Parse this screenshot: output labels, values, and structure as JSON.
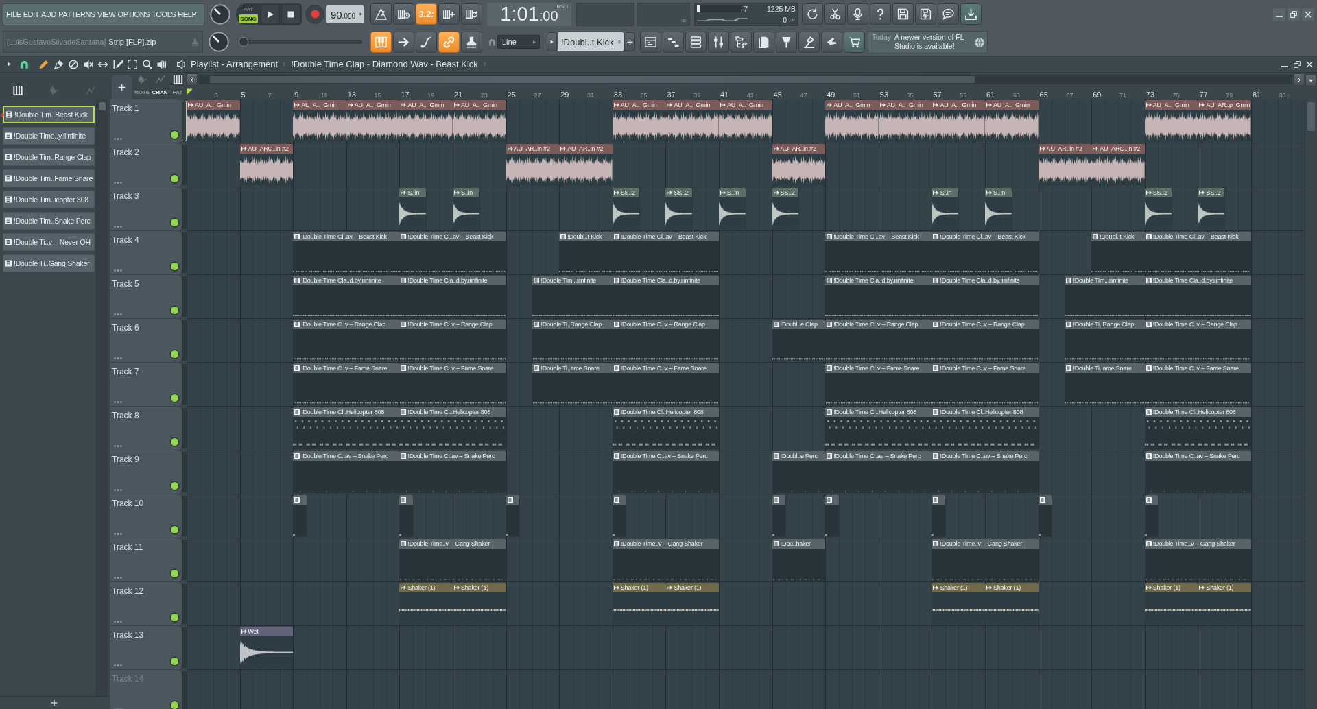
{
  "menu": [
    "FILE",
    "EDIT",
    "ADD",
    "PATTERNS",
    "VIEW",
    "OPTIONS",
    "TOOLS",
    "HELP"
  ],
  "mode": [
    {
      "label": "PAT",
      "selected": false
    },
    {
      "label": "SONG",
      "selected": true
    }
  ],
  "tempo": "90.000",
  "record_options": [
    {
      "on": false
    },
    {
      "on": false
    },
    {
      "label": "3.2:",
      "on": true
    },
    {
      "on": false
    },
    {
      "on": false
    }
  ],
  "time": {
    "value": "1:01:00",
    "units": "B:S:T"
  },
  "cpu_meter": {
    "level": 0.06
  },
  "readings": [
    "7",
    "1225 MB",
    "0"
  ],
  "hint": {
    "prefix": "[LuisGustavoSilvadeSantana]",
    "text": "Strip [FLP].zip"
  },
  "song_position": {
    "level": 0
  },
  "snap_tools": [
    {
      "on": true
    },
    {
      "on": false
    },
    {
      "on": false
    },
    {
      "on": true
    },
    {
      "on": false
    }
  ],
  "snap": "Line",
  "pattern": "!Doubl..t Kick",
  "news": {
    "date": "Today",
    "text": "A newer version of FL Studio is available!"
  },
  "playlist": {
    "title": "Playlist - Arrangement",
    "pattern": "!Double Time Clap - Diamond Wav - Beast Kick",
    "tools": [
      {
        "selected": true
      },
      {
        "selected": false
      },
      {
        "selected": false
      },
      {
        "selected": false
      },
      {
        "selected": false
      },
      {
        "selected": false
      },
      {
        "selected": false
      },
      {
        "selected": false
      },
      {
        "selected": false
      }
    ],
    "picker_filters": [
      {
        "on": true
      },
      {
        "on": false
      },
      {
        "on": false
      }
    ],
    "view_toggles": [
      {
        "on": false
      },
      {
        "on": false
      },
      {
        "on": true
      }
    ],
    "clip_filters": [
      {
        "label": "NOTE",
        "selected": false
      },
      {
        "label": "CHAN",
        "selected": true
      },
      {
        "label": "PAT",
        "selected": false
      }
    ],
    "picker": [
      {
        "label": "!Double Tim..Beast Kick",
        "selected": true
      },
      {
        "label": "!Double Time..y.iiinfinite",
        "selected": false
      },
      {
        "label": "!Double Tim..Range Clap",
        "selected": false
      },
      {
        "label": "!Double Tim..Fame Snare",
        "selected": false
      },
      {
        "label": "!Double Tim..icopter 808",
        "selected": false
      },
      {
        "label": "!Double Tim..Snake Perc",
        "selected": false
      },
      {
        "label": "!Double Ti..v – Never OH",
        "selected": false
      },
      {
        "label": "!Double Ti..Gang Shaker",
        "selected": false
      }
    ],
    "ruler": [
      "3",
      "5",
      "7",
      "9",
      "11",
      "13",
      "15",
      "17",
      "19",
      "21",
      "23",
      "25",
      "27",
      "29",
      "31",
      "33",
      "35",
      "37",
      "39",
      "41",
      "43",
      "45",
      "47",
      "49",
      "51",
      "53",
      "55",
      "57",
      "59",
      "61",
      "63",
      "65",
      "67",
      "69",
      "71",
      "73",
      "75",
      "77",
      "79",
      "81",
      "83"
    ],
    "tracks": [
      {
        "name": "Track 1",
        "selected": true,
        "muted": false,
        "dimmed": false,
        "clips": [
          {
            "kind": "audio",
            "label": "AU_A.._Gmin",
            "color": "#7d5b59"
          },
          {
            "kind": "audio",
            "label": "AU_A.._Gmin",
            "color": "#7d5b59"
          },
          {
            "kind": "audio",
            "label": "AU_A.._Gmin",
            "color": "#7d5b59"
          },
          {
            "kind": "audio",
            "label": "AU_A.._Gmin",
            "color": "#7d5b59"
          },
          {
            "kind": "audio",
            "label": "AU_A.._Gmin",
            "color": "#7d5b59"
          },
          {
            "kind": "audio",
            "label": "AU_A.._Gmin",
            "color": "#7d5b59"
          },
          {
            "kind": "audio",
            "label": "AU_A.._Gmin",
            "color": "#7d5b59"
          },
          {
            "kind": "audio",
            "label": "AU_A.._Gmin",
            "color": "#7d5b59"
          },
          {
            "kind": "audio",
            "label": "AU_A.._Gmin",
            "color": "#7d5b59"
          },
          {
            "kind": "audio",
            "label": "AU_A.._Gmin",
            "color": "#7d5b59"
          },
          {
            "kind": "audio",
            "label": "AU_A.._Gmin",
            "color": "#7d5b59"
          },
          {
            "kind": "audio",
            "label": "AU_A.._Gmin",
            "color": "#7d5b59"
          },
          {
            "kind": "audio",
            "label": "AU_A.._Gmin",
            "color": "#7d5b59"
          },
          {
            "kind": "audio",
            "label": "AU_AR..p_Gmin",
            "color": "#7d5b59"
          }
        ]
      },
      {
        "name": "Track 2",
        "selected": false,
        "muted": false,
        "dimmed": false,
        "clips": [
          {
            "kind": "audio",
            "label": "AU_ARG..in #2",
            "color": "#7d5b59"
          },
          {
            "kind": "audio",
            "label": "AU_AR..in #2",
            "color": "#7d5b59"
          },
          {
            "kind": "audio",
            "label": "AU_AR..in #2",
            "color": "#7d5b59"
          },
          {
            "kind": "audio",
            "label": "AU_AR..in #2",
            "color": "#7d5b59"
          },
          {
            "kind": "audio",
            "label": "AU_AR..in #2",
            "color": "#7d5b59"
          },
          {
            "kind": "audio",
            "label": "AU_ARG..in #2",
            "color": "#7d5b59"
          }
        ]
      },
      {
        "name": "Track 3",
        "selected": false,
        "muted": false,
        "dimmed": false,
        "clips": [
          {
            "kind": "audio",
            "label": "S..in",
            "color": "#5a6d66"
          },
          {
            "kind": "audio",
            "label": "S..in",
            "color": "#5a6d66"
          },
          {
            "kind": "audio",
            "label": "SS..2",
            "color": "#5a6d66"
          },
          {
            "kind": "audio",
            "label": "SS..2",
            "color": "#5a6d66"
          },
          {
            "kind": "audio",
            "label": "S..in",
            "color": "#5a6d66"
          },
          {
            "kind": "audio",
            "label": "SS..2",
            "color": "#5a6d66"
          },
          {
            "kind": "audio",
            "label": "S..in",
            "color": "#5a6d66"
          },
          {
            "kind": "audio",
            "label": "S..in",
            "color": "#5a6d66"
          },
          {
            "kind": "audio",
            "label": "SS..2",
            "color": "#5a6d66"
          },
          {
            "kind": "audio",
            "label": "SS..2",
            "color": "#5a6d66"
          }
        ]
      },
      {
        "name": "Track 4",
        "selected": false,
        "muted": false,
        "dimmed": false,
        "clips": [
          {
            "kind": "pattern",
            "label": "!Double Time Cl..av – Beast Kick",
            "color": "#58636a"
          },
          {
            "kind": "pattern",
            "label": "!Double Time Cl..av – Beast Kick",
            "color": "#58636a"
          },
          {
            "kind": "pattern",
            "label": "!Doubl..t Kick",
            "color": "#58636a"
          },
          {
            "kind": "pattern",
            "label": "!Double Time Cl..av – Beast Kick",
            "color": "#58636a"
          },
          {
            "kind": "pattern",
            "label": "!Double Time Cl..av – Beast Kick",
            "color": "#58636a"
          },
          {
            "kind": "pattern",
            "label": "!Double Time Cl..av – Beast Kick",
            "color": "#58636a"
          },
          {
            "kind": "pattern",
            "label": "!Doubl..t Kick",
            "color": "#58636a"
          },
          {
            "kind": "pattern",
            "label": "!Double Time Cl..av – Beast Kick",
            "color": "#58636a"
          }
        ]
      },
      {
        "name": "Track 5",
        "selected": false,
        "muted": false,
        "dimmed": false,
        "clips": [
          {
            "kind": "pattern",
            "label": "!Double Time Cla..d.by.iiinfinite",
            "color": "#58636a"
          },
          {
            "kind": "pattern",
            "label": "!Double Time Cla..d.by.iiinfinite",
            "color": "#58636a"
          },
          {
            "kind": "pattern",
            "label": "!Double Tim...iiinfinite",
            "color": "#58636a"
          },
          {
            "kind": "pattern",
            "label": "!Double Time Cla..d.by.iiinfinite",
            "color": "#58636a"
          },
          {
            "kind": "pattern",
            "label": "!Double Time Cla..d.by.iiinfinite",
            "color": "#58636a"
          },
          {
            "kind": "pattern",
            "label": "!Double Time Cla..d.by.iiinfinite",
            "color": "#58636a"
          },
          {
            "kind": "pattern",
            "label": "!Double Tim...iiinfinite",
            "color": "#58636a"
          },
          {
            "kind": "pattern",
            "label": "!Double Time Cla..d.by.iiinfinite",
            "color": "#58636a"
          }
        ]
      },
      {
        "name": "Track 6",
        "selected": false,
        "muted": false,
        "dimmed": false,
        "clips": [
          {
            "kind": "pattern",
            "label": "!Double Time C..v – Range Clap",
            "color": "#58636a"
          },
          {
            "kind": "pattern",
            "label": "!Double Time C..v – Range Clap",
            "color": "#58636a"
          },
          {
            "kind": "pattern",
            "label": "!Double Ti..Range Clap",
            "color": "#58636a"
          },
          {
            "kind": "pattern",
            "label": "!Double Time C..v – Range Clap",
            "color": "#58636a"
          },
          {
            "kind": "pattern",
            "label": "!Doubl..e Clap",
            "color": "#58636a"
          },
          {
            "kind": "pattern",
            "label": "!Double Time C..v – Range Clap",
            "color": "#58636a"
          },
          {
            "kind": "pattern",
            "label": "!Double Time C..v – Range Clap",
            "color": "#58636a"
          },
          {
            "kind": "pattern",
            "label": "!Double Ti..Range Clap",
            "color": "#58636a"
          },
          {
            "kind": "pattern",
            "label": "!Double Time C..v – Range Clap",
            "color": "#58636a"
          }
        ]
      },
      {
        "name": "Track 7",
        "selected": false,
        "muted": false,
        "dimmed": false,
        "clips": [
          {
            "kind": "pattern",
            "label": "!Double Time C..v – Fame Snare",
            "color": "#58636a"
          },
          {
            "kind": "pattern",
            "label": "!Double Time C..v – Fame Snare",
            "color": "#58636a"
          },
          {
            "kind": "pattern",
            "label": "!Double Ti..ame Snare",
            "color": "#58636a"
          },
          {
            "kind": "pattern",
            "label": "!Double Time C..v – Fame Snare",
            "color": "#58636a"
          },
          {
            "kind": "pattern",
            "label": "!Double Time C..v – Fame Snare",
            "color": "#58636a"
          },
          {
            "kind": "pattern",
            "label": "!Double Time C..v – Fame Snare",
            "color": "#58636a"
          },
          {
            "kind": "pattern",
            "label": "!Double Ti..ame Snare",
            "color": "#58636a"
          },
          {
            "kind": "pattern",
            "label": "!Double Time C..v – Fame Snare",
            "color": "#58636a"
          }
        ]
      },
      {
        "name": "Track 8",
        "selected": false,
        "muted": false,
        "dimmed": false,
        "clips": [
          {
            "kind": "pattern",
            "label": "!Double Time Cl..Helicopter 808",
            "color": "#58636a"
          },
          {
            "kind": "pattern",
            "label": "!Double Time Cl..Helicopter 808",
            "color": "#58636a"
          },
          {
            "kind": "pattern",
            "label": "!Double Time Cl..Helicopter 808",
            "color": "#58636a"
          },
          {
            "kind": "pattern",
            "label": "!Double Time Cl..Helicopter 808",
            "color": "#58636a"
          },
          {
            "kind": "pattern",
            "label": "!Double Time Cl..Helicopter 808",
            "color": "#58636a"
          },
          {
            "kind": "pattern",
            "label": "!Double Time Cl..Helicopter 808",
            "color": "#58636a"
          }
        ]
      },
      {
        "name": "Track 9",
        "selected": false,
        "muted": false,
        "dimmed": false,
        "clips": [
          {
            "kind": "pattern",
            "label": "!Double Time C..av – Snake Perc",
            "color": "#58636a"
          },
          {
            "kind": "pattern",
            "label": "!Double Time C..av – Snake Perc",
            "color": "#58636a"
          },
          {
            "kind": "pattern",
            "label": "!Double Time C..av – Snake Perc",
            "color": "#58636a"
          },
          {
            "kind": "pattern",
            "label": "!Doubl..e Perc",
            "color": "#58636a"
          },
          {
            "kind": "pattern",
            "label": "!Double Time C..av – Snake Perc",
            "color": "#58636a"
          },
          {
            "kind": "pattern",
            "label": "!Double Time C..av – Snake Perc",
            "color": "#58636a"
          },
          {
            "kind": "pattern",
            "label": "!Double Time C..av – Snake Perc",
            "color": "#58636a"
          }
        ]
      },
      {
        "name": "Track 10",
        "selected": false,
        "muted": false,
        "dimmed": false,
        "clips": [
          {
            "kind": "pattern",
            "color": "#58636a"
          },
          {
            "kind": "pattern",
            "color": "#58636a"
          },
          {
            "kind": "pattern",
            "color": "#58636a"
          },
          {
            "kind": "pattern",
            "color": "#58636a"
          },
          {
            "kind": "pattern",
            "color": "#58636a"
          },
          {
            "kind": "pattern",
            "color": "#58636a"
          },
          {
            "kind": "pattern",
            "color": "#58636a"
          },
          {
            "kind": "pattern",
            "color": "#58636a"
          },
          {
            "kind": "pattern",
            "color": "#58636a"
          }
        ]
      },
      {
        "name": "Track 11",
        "selected": false,
        "muted": false,
        "dimmed": false,
        "clips": [
          {
            "kind": "pattern",
            "label": "!Double Time..v – Gang Shaker",
            "color": "#58636a"
          },
          {
            "kind": "pattern",
            "label": "!Double Time..v – Gang Shaker",
            "color": "#58636a"
          },
          {
            "kind": "pattern",
            "label": "!Dou..haker",
            "color": "#58636a"
          },
          {
            "kind": "pattern",
            "label": "!Double Time..v – Gang Shaker",
            "color": "#58636a"
          },
          {
            "kind": "pattern",
            "label": "!Double Time..v – Gang Shaker",
            "color": "#58636a"
          }
        ]
      },
      {
        "name": "Track 12",
        "selected": false,
        "muted": false,
        "dimmed": false,
        "clips": [
          {
            "kind": "audio",
            "label": "Shaker (1)",
            "color": "#6e6a4b"
          },
          {
            "kind": "audio",
            "label": "Shaker (1)",
            "color": "#6e6a4b"
          },
          {
            "kind": "audio",
            "label": "Shaker (1)",
            "color": "#6e6a4b"
          },
          {
            "kind": "audio",
            "label": "Shaker (1)",
            "color": "#6e6a4b"
          },
          {
            "kind": "audio",
            "label": "Shaker (1)",
            "color": "#6e6a4b"
          },
          {
            "kind": "audio",
            "label": "Shaker (1)",
            "color": "#6e6a4b"
          },
          {
            "kind": "audio",
            "label": "Shaker (1)",
            "color": "#6e6a4b"
          },
          {
            "kind": "audio",
            "label": "Shaker (1)",
            "color": "#6e6a4b"
          }
        ]
      },
      {
        "name": "Track 13",
        "selected": false,
        "muted": false,
        "dimmed": false,
        "clips": [
          {
            "kind": "audio",
            "label": "Wet",
            "color": "#62637a"
          }
        ]
      },
      {
        "name": "Track 14",
        "selected": false,
        "muted": false,
        "dimmed": true
      }
    ]
  }
}
